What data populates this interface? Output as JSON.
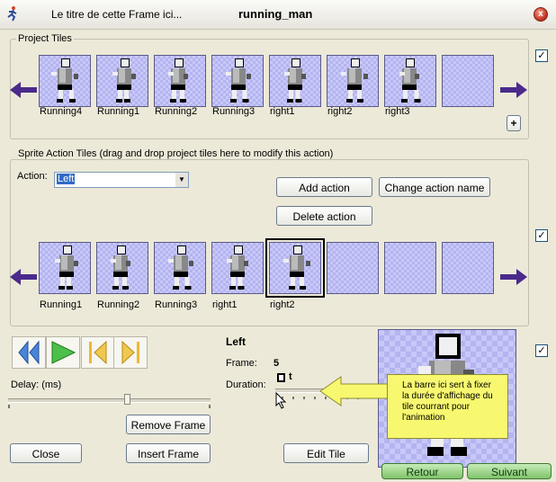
{
  "window": {
    "title_left": "Le titre de cette Frame ici...",
    "title": "running_man",
    "close_glyph": "x"
  },
  "project_tiles": {
    "legend": "Project Tiles",
    "tiles": [
      {
        "label": "Running4",
        "pose": "run-a"
      },
      {
        "label": "Running1",
        "pose": "run-b"
      },
      {
        "label": "Running2",
        "pose": "run-c"
      },
      {
        "label": "Running3",
        "pose": "run-d"
      },
      {
        "label": "right1",
        "pose": "right-a"
      },
      {
        "label": "right2",
        "pose": "right-b"
      },
      {
        "label": "right3",
        "pose": "right-c"
      },
      {
        "label": "",
        "pose": "empty"
      }
    ],
    "plus_label": "+",
    "checked": true
  },
  "sprite_action": {
    "legend": "Sprite Action Tiles (drag and drop project tiles here to modify this action)",
    "action_label": "Action:",
    "action_value": "Left",
    "add_action": "Add action",
    "change_action_name": "Change action name",
    "delete_action": "Delete action",
    "tiles": [
      {
        "label": "Running1",
        "pose": "run-b"
      },
      {
        "label": "Running2",
        "pose": "run-c"
      },
      {
        "label": "Running3",
        "pose": "run-d"
      },
      {
        "label": "right1",
        "pose": "right-a"
      },
      {
        "label": "right2",
        "pose": "right-b"
      },
      {
        "label": "",
        "pose": "empty"
      },
      {
        "label": "",
        "pose": "empty"
      },
      {
        "label": "",
        "pose": "empty"
      }
    ],
    "checked": true
  },
  "frame_editor": {
    "action_name": "Left",
    "frame_label": "Frame:",
    "frame_value": "5",
    "duration_label": "Duration:",
    "duration_glyph": "t",
    "delay_label": "Delay: (ms)",
    "remove_frame": "Remove Frame",
    "insert_frame": "Insert Frame",
    "edit_tile": "Edit Tile",
    "close": "Close",
    "preview_checked": true
  },
  "callout": {
    "text": "La barre ici sert à fixer la durée d'affichage du tile courrant pour l'animation"
  },
  "nav": {
    "back": "Retour",
    "next": "Suivant"
  },
  "colors": {
    "accent_arrow": "#4a2a8c",
    "tile_bg": "#c8c8f8",
    "callout_bg": "#f8f870",
    "nav_green": "#7fc36a"
  },
  "icons": [
    "app-icon",
    "close-icon",
    "left-arrow-icon",
    "right-arrow-icon",
    "rewind-icon",
    "play-icon",
    "prev-frame-icon",
    "next-frame-icon",
    "mouse-pointer-icon"
  ]
}
